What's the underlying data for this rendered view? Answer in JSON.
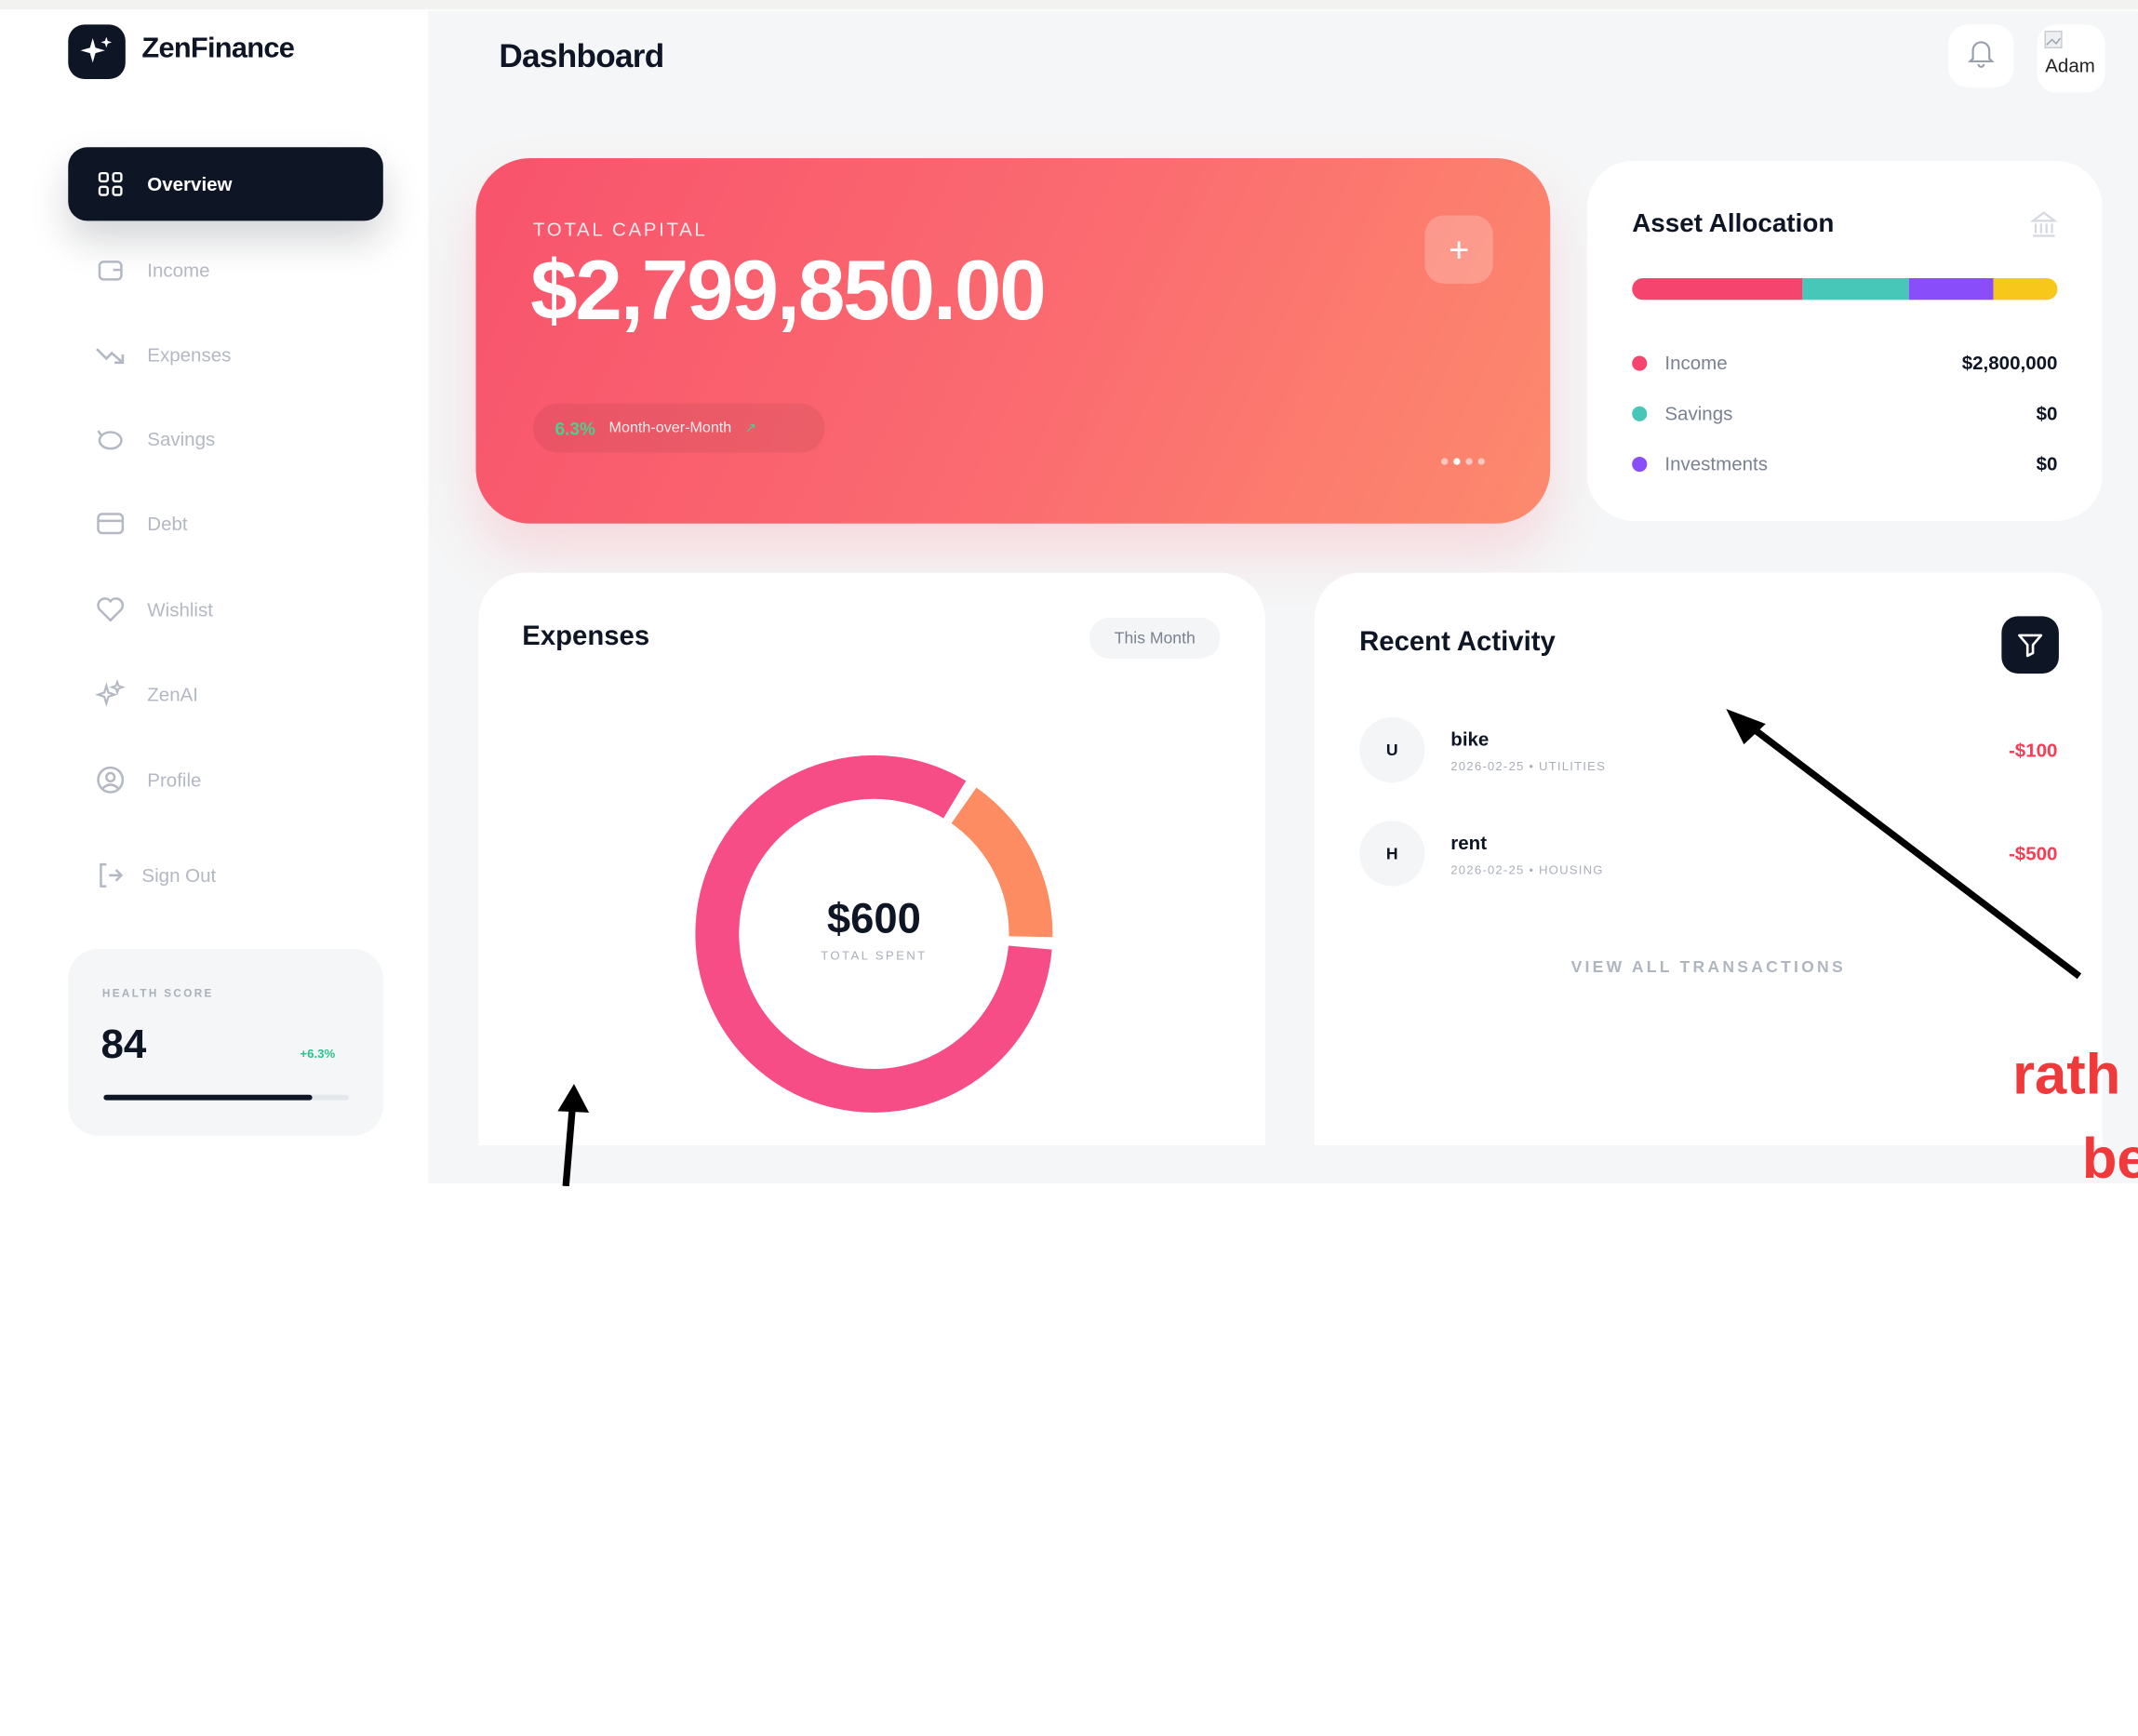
{
  "app": {
    "name": "ZenFinance"
  },
  "sidebar": {
    "items": [
      {
        "label": "Overview",
        "icon": "grid-icon",
        "active": true
      },
      {
        "label": "Income",
        "icon": "wallet-icon"
      },
      {
        "label": "Expenses",
        "icon": "trend-down-icon"
      },
      {
        "label": "Savings",
        "icon": "piggy-bank-icon"
      },
      {
        "label": "Debt",
        "icon": "credit-card-icon"
      },
      {
        "label": "Wishlist",
        "icon": "heart-icon"
      },
      {
        "label": "ZenAI",
        "icon": "sparkles-icon"
      },
      {
        "label": "Profile",
        "icon": "user-circle-icon"
      }
    ],
    "sign_out": "Sign Out",
    "health": {
      "label": "HEALTH SCORE",
      "value": "84",
      "delta": "+6.3%",
      "progress": 0.85
    }
  },
  "header": {
    "title": "Dashboard",
    "avatar_alt": "Adam"
  },
  "capital": {
    "label": "TOTAL CAPITAL",
    "amount": "$2,799,850.00",
    "badge_pct": "6.3%",
    "badge_text": "Month-over-Month",
    "badge_arrow": "↗",
    "add_label": "+"
  },
  "allocation": {
    "title": "Asset Allocation",
    "bar_segments": [
      {
        "color": "#f5456f",
        "share": 0.4
      },
      {
        "color": "#47c7b8",
        "share": 0.25
      },
      {
        "color": "#8a4dfa",
        "share": 0.2
      },
      {
        "color": "#f7c81b",
        "share": 0.15
      }
    ],
    "rows": [
      {
        "label": "Income",
        "value": "$2,800,000",
        "color": "#f5456f"
      },
      {
        "label": "Savings",
        "value": "$0",
        "color": "#47c7b8"
      },
      {
        "label": "Investments",
        "value": "$0",
        "color": "#8a4dfa"
      }
    ]
  },
  "expenses": {
    "title": "Expenses",
    "period": "This Month",
    "total": "$600",
    "total_label": "TOTAL SPENT",
    "segments": [
      {
        "value": 500,
        "color": "#f74d86"
      },
      {
        "value": 100,
        "color": "#fd8c63"
      }
    ]
  },
  "activity": {
    "title": "Recent Activity",
    "items": [
      {
        "initial": "U",
        "name": "bike",
        "meta": "2026-02-25 • UTILITIES",
        "amount": "-$100"
      },
      {
        "initial": "H",
        "name": "rent",
        "meta": "2026-02-25 • HOUSING",
        "amount": "-$500"
      }
    ],
    "view_all": "VIEW ALL TRANSACTIONS"
  },
  "annotation": {
    "line1": "rath",
    "line2": "be"
  }
}
